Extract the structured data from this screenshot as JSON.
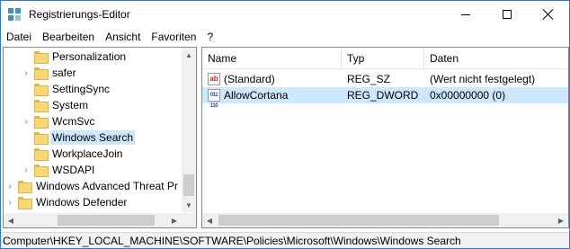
{
  "window": {
    "title": "Registrierungs-Editor"
  },
  "menu": [
    "Datei",
    "Bearbeiten",
    "Ansicht",
    "Favoriten",
    "?"
  ],
  "tree": {
    "items": [
      {
        "label": "Personalization",
        "expandable": false,
        "level": 2,
        "selected": false
      },
      {
        "label": "safer",
        "expandable": true,
        "level": 2,
        "selected": false
      },
      {
        "label": "SettingSync",
        "expandable": false,
        "level": 2,
        "selected": false
      },
      {
        "label": "System",
        "expandable": false,
        "level": 2,
        "selected": false
      },
      {
        "label": "WcmSvc",
        "expandable": true,
        "level": 2,
        "selected": false
      },
      {
        "label": "Windows Search",
        "expandable": false,
        "level": 2,
        "selected": true
      },
      {
        "label": "WorkplaceJoin",
        "expandable": false,
        "level": 2,
        "selected": false
      },
      {
        "label": "WSDAPI",
        "expandable": true,
        "level": 2,
        "selected": false
      },
      {
        "label": "Windows Advanced Threat Pr",
        "expandable": true,
        "level": 1,
        "selected": false
      },
      {
        "label": "Windows Defender",
        "expandable": true,
        "level": 1,
        "selected": false
      }
    ]
  },
  "list": {
    "columns": [
      "Name",
      "Typ",
      "Daten"
    ],
    "rows": [
      {
        "icon": "string-value-icon",
        "icon_text": "ab",
        "name": "(Standard)",
        "type": "REG_SZ",
        "data": "(Wert nicht festgelegt)",
        "selected": false
      },
      {
        "icon": "dword-value-icon",
        "icon_text": "011 110",
        "name": "AllowCortana",
        "type": "REG_DWORD",
        "data": "0x00000000 (0)",
        "selected": true
      }
    ]
  },
  "status": {
    "path": "Computer\\HKEY_LOCAL_MACHINE\\SOFTWARE\\Policies\\Microsoft\\Windows\\Windows Search"
  },
  "colors": {
    "selection": "#cce8ff",
    "folder": "#f8d775",
    "accent": "#2b78d6"
  }
}
